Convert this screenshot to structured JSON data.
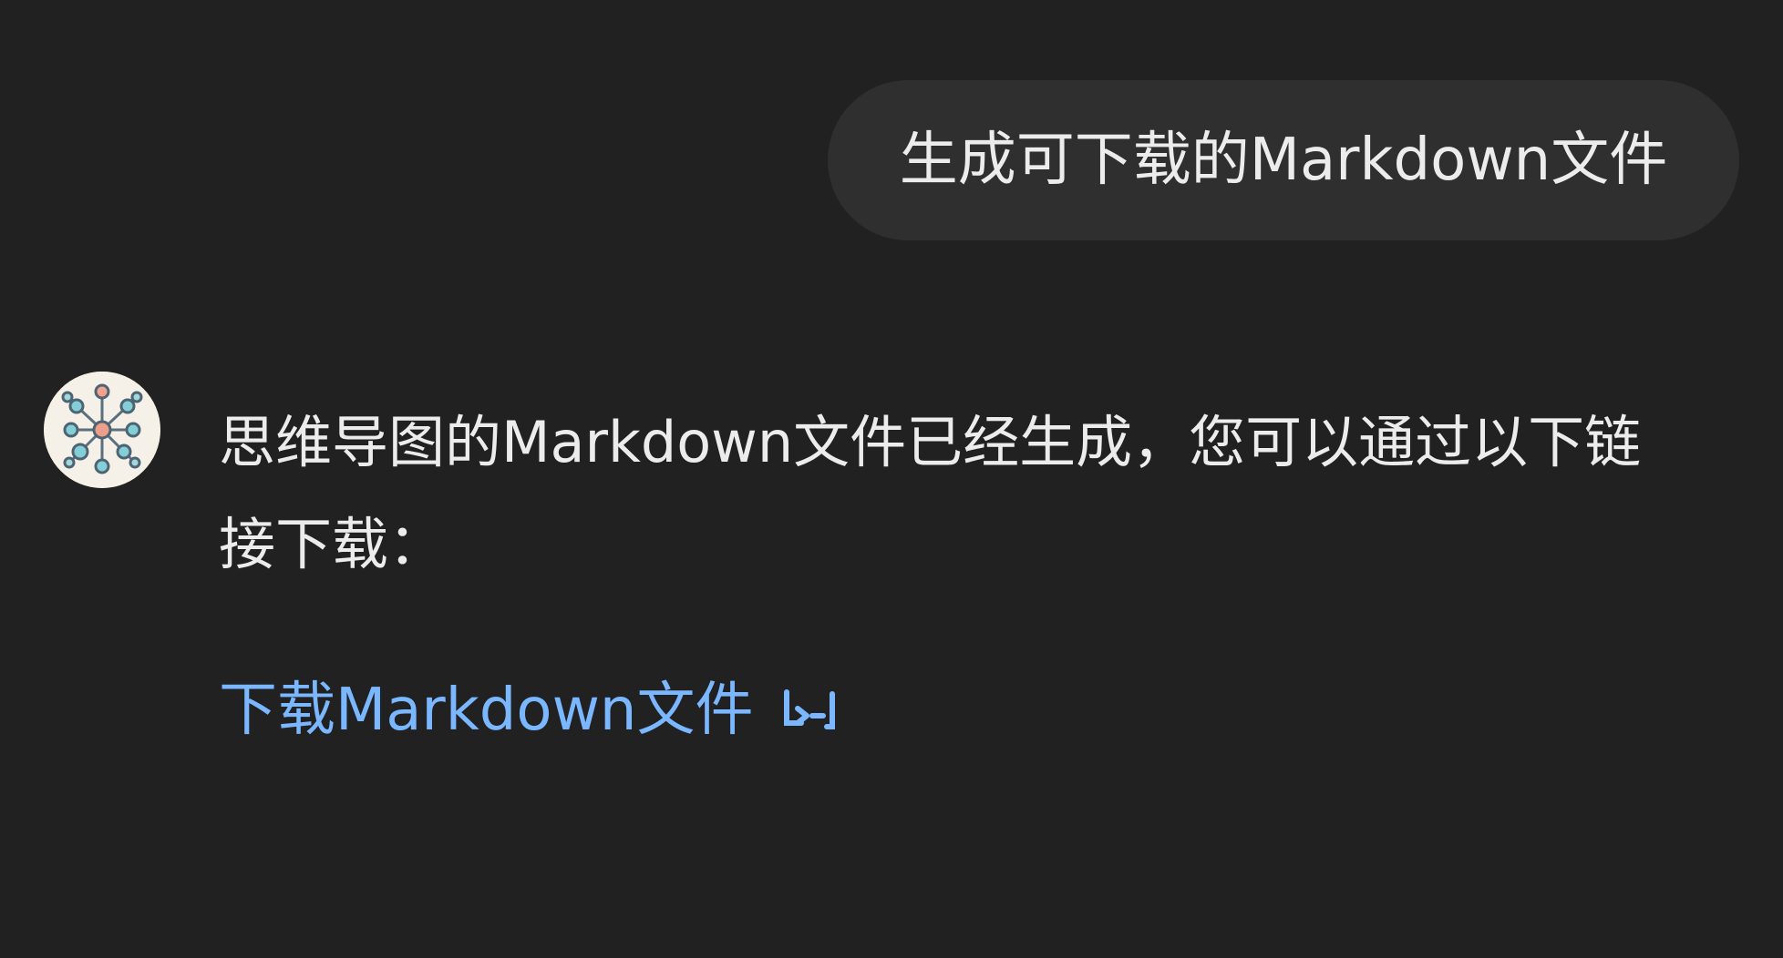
{
  "conversation": {
    "user_message": "生成可下载的Markdown文件",
    "assistant_message": "思维导图的Markdown文件已经生成，您可以通过以下链接下载：",
    "download_link_label": "下载Markdown文件"
  },
  "icons": {
    "assistant_avatar": "mind-map-avatar-icon",
    "download_icon": "download-arrow-icon"
  },
  "colors": {
    "background": "#212121",
    "user_bubble": "#2f2f2f",
    "text": "#ececec",
    "link": "#7ab7ff"
  }
}
